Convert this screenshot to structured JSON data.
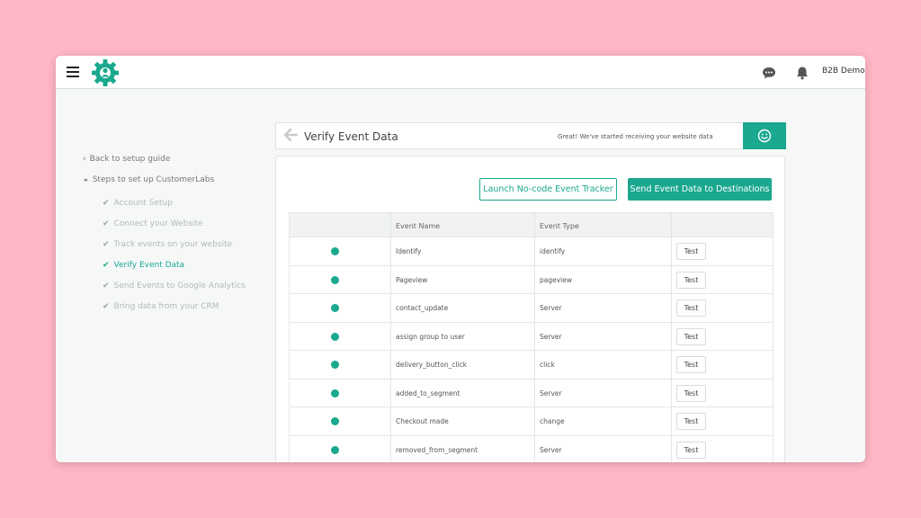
{
  "topbar": {
    "user_name": "B2B Demo",
    "icons": [
      "menu-icon",
      "gear-logo-icon",
      "chat-icon",
      "bell-icon"
    ]
  },
  "sidebar": {
    "back_link": "Back to setup guide",
    "steps_heading": "Steps to set up CustomerLabs",
    "steps": [
      {
        "label": "Account Setup",
        "active": false
      },
      {
        "label": "Connect your Website",
        "active": false
      },
      {
        "label": "Track events on your website",
        "active": false
      },
      {
        "label": "Verify Event Data",
        "active": true
      },
      {
        "label": "Send Events to Google Analytics",
        "active": false
      },
      {
        "label": "Bring data from your CRM",
        "active": false
      }
    ]
  },
  "header": {
    "title": "Verify Event Data",
    "message": "Great! We've started receiving your website data"
  },
  "actions": {
    "launch_label": "Launch No-code Event Tracker",
    "send_label": "Send Event Data to Destinations"
  },
  "table": {
    "columns": [
      "",
      "Event Name",
      "Event Type",
      ""
    ],
    "test_label": "Test",
    "rows": [
      {
        "name": "Identify",
        "type": "identify"
      },
      {
        "name": "Pageview",
        "type": "pageview"
      },
      {
        "name": "contact_update",
        "type": "Server"
      },
      {
        "name": "assign group to user",
        "type": "Server"
      },
      {
        "name": "delivery_button_click",
        "type": "click"
      },
      {
        "name": "added_to_segment",
        "type": "Server"
      },
      {
        "name": "Checkout made",
        "type": "change"
      },
      {
        "name": "removed_from_segment",
        "type": "Server"
      }
    ]
  },
  "colors": {
    "accent": "#1aa88e",
    "background": "#ffb6c5"
  }
}
